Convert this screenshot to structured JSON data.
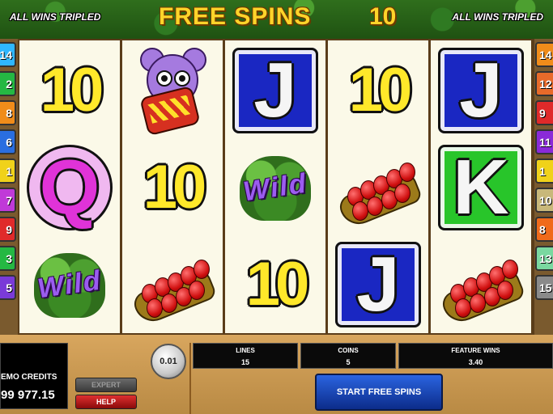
{
  "banner": {
    "left_text": "ALL WINS TRIPLED",
    "right_text": "ALL WINS TRIPLED",
    "title": "FREE SPINS",
    "spins_left": "10"
  },
  "left_markers": [
    {
      "label": "14",
      "color": "#2fb7ff"
    },
    {
      "label": "2",
      "color": "#25b843"
    },
    {
      "label": "8",
      "color": "#f08c1a"
    },
    {
      "label": "6",
      "color": "#2a6ee0"
    },
    {
      "label": "1",
      "color": "#f0d21a"
    },
    {
      "label": "7",
      "color": "#c03ad8"
    },
    {
      "label": "9",
      "color": "#e02a2a"
    },
    {
      "label": "3",
      "color": "#25b843"
    },
    {
      "label": "5",
      "color": "#7a3ad8"
    }
  ],
  "right_markers": [
    {
      "label": "14",
      "color": "#f08c1a"
    },
    {
      "label": "12",
      "color": "#e86a2a"
    },
    {
      "label": "9",
      "color": "#e02a2a"
    },
    {
      "label": "11",
      "color": "#8a2ad8"
    },
    {
      "label": "1",
      "color": "#f0d21a"
    },
    {
      "label": "10",
      "color": "#c8b87a"
    },
    {
      "label": "8",
      "color": "#f06a1a"
    },
    {
      "label": "13",
      "color": "#7ad8a0"
    },
    {
      "label": "15",
      "color": "#8a8a8a"
    }
  ],
  "reels": [
    [
      "10",
      "Q",
      "wild"
    ],
    [
      "monkey",
      "10",
      "chili"
    ],
    [
      "J",
      "wild",
      "10"
    ],
    [
      "10",
      "chili",
      "J"
    ],
    [
      "J",
      "K",
      "chili"
    ]
  ],
  "symbols": {
    "wild_text": "Wild"
  },
  "panel": {
    "credits_label": "EMO CREDITS",
    "credits_value": "99 977.15",
    "expert_label": "EXPERT",
    "help_label": "HELP",
    "coin_value": "0.01",
    "lines_label": "LINES",
    "lines_value": "15",
    "coins_label": "COINS",
    "coins_value": "5",
    "feature_label": "FEATURE WINS",
    "feature_value": "3.40",
    "start_label": "START FREE SPINS"
  }
}
